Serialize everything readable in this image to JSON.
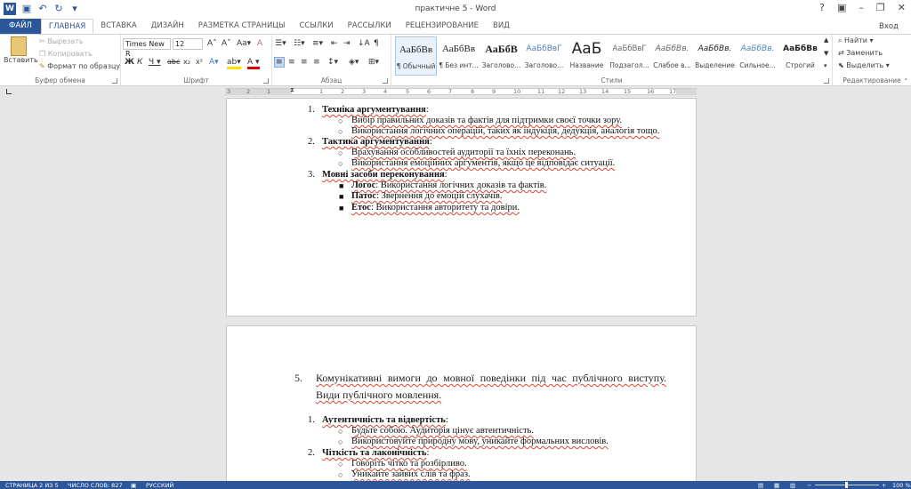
{
  "window": {
    "title": "практичне 5 - Word",
    "help": "?",
    "signin": "Вход"
  },
  "tabs": [
    "ФАЙЛ",
    "ГЛАВНАЯ",
    "ВСТАВКА",
    "ДИЗАЙН",
    "РАЗМЕТКА СТРАНИЦЫ",
    "ССЫЛКИ",
    "РАССЫЛКИ",
    "РЕЦЕНЗИРОВАНИЕ",
    "ВИД"
  ],
  "clipboard": {
    "paste": "Вставить",
    "cut": "Вырезать",
    "copy": "Копировать",
    "format": "Формат по образцу",
    "label": "Буфер обмена"
  },
  "font": {
    "name": "Times New R",
    "size": "12",
    "label": "Шрифт"
  },
  "paragraph": {
    "label": "Абзац"
  },
  "styles": {
    "label": "Стили",
    "items": [
      {
        "preview": "АаБбВв",
        "name": "¶ Обычный"
      },
      {
        "preview": "АаБбВв",
        "name": "¶ Без инт..."
      },
      {
        "preview": "АаБбВ",
        "name": "Заголово..."
      },
      {
        "preview": "АаБбВвГ",
        "name": "Заголово..."
      },
      {
        "preview": "АаБ",
        "name": "Название"
      },
      {
        "preview": "АаБбВвГ",
        "name": "Подзагол..."
      },
      {
        "preview": "АаБбВв.",
        "name": "Слабое в..."
      },
      {
        "preview": "АаБбВв.",
        "name": "Выделение"
      },
      {
        "preview": "АаБбВв.",
        "name": "Сильное..."
      },
      {
        "preview": "АаБбВв",
        "name": "Строгий"
      }
    ]
  },
  "editing": {
    "find": "Найти",
    "replace": "Заменить",
    "select": "Выделить",
    "label": "Редактирование"
  },
  "ruler": [
    "3",
    "2",
    "1",
    "1",
    "2",
    "3",
    "4",
    "5",
    "6",
    "7",
    "8",
    "9",
    "10",
    "11",
    "12",
    "13",
    "14",
    "15",
    "16",
    "17"
  ],
  "page1": {
    "n1": "1.",
    "h1": "Техніка аргументування",
    "h1_colon": ":",
    "b1a": "Вибір правильних доказів та фактів для підтримки своєї точки зору.",
    "b1b": "Використання логічних операцій, таких як індукція, дедукція, аналогія тощо.",
    "n2": "2.",
    "h2": "Тактика аргументування",
    "h2_colon": ":",
    "b2a": "Врахування особливостей аудиторії та їхніх переконань.",
    "b2b": "Використання емоційних аргументів, якщо це відповідає ситуації.",
    "n3": "3.",
    "h3": "Мовні засоби переконування",
    "h3_colon": ":",
    "logos_t": "Логос",
    "logos_d": ": Використання логічних доказів та фактів.",
    "pathos_t": "Патос",
    "pathos_d": ": Звернення до емоцій слухачів.",
    "ethos_t": "Етос",
    "ethos_d": ": Використання авторитету та довіри."
  },
  "page2": {
    "n5": "5.",
    "title1": "Комунікативні вимоги до мовної поведінки під час публічного виступу.",
    "title2": "Види публічного мовлення.",
    "n1": "1.",
    "h1": "Аутентичність та відвертість",
    "h1_colon": ":",
    "b1a": "Будьте собою. Аудиторія цінує автентичність.",
    "b1b": "Використовуйте природну мову, уникайте формальних висловів.",
    "n2": "2.",
    "h2": "Чіткість та лаконічність",
    "h2_colon": ":",
    "b2a": "Говоріть чітко та розбірливо.",
    "b2b": "Уникайте зайвих слів та фраз."
  },
  "status": {
    "page": "СТРАНИЦА 2 ИЗ 5",
    "words": "ЧИСЛО СЛОВ: 827",
    "lang": "РУССКИЙ",
    "zoom": "100 %"
  }
}
